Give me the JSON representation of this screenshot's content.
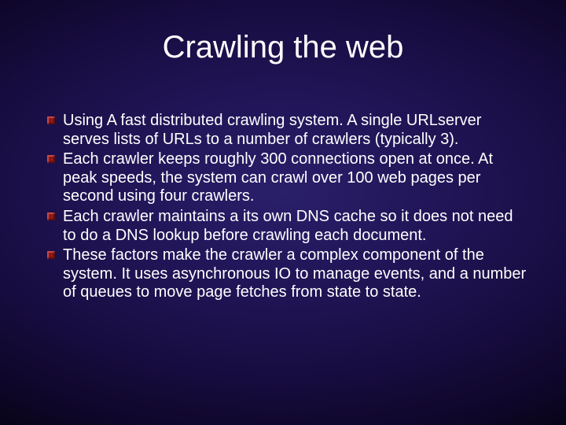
{
  "slide": {
    "title": "Crawling the web",
    "bullets": [
      "Using A fast distributed crawling system. A single URLserver serves lists of URLs to a number of crawlers (typically 3).",
      "Each crawler keeps roughly 300 connections open at once. At peak speeds, the system can crawl over 100 web pages per second using four crawlers.",
      "Each crawler maintains a its own DNS cache so it does not need to do a DNS lookup before crawling each document.",
      "These factors make the crawler a complex component of the system. It uses asynchronous IO to manage events, and a number of queues to move page fetches from state to state."
    ]
  }
}
